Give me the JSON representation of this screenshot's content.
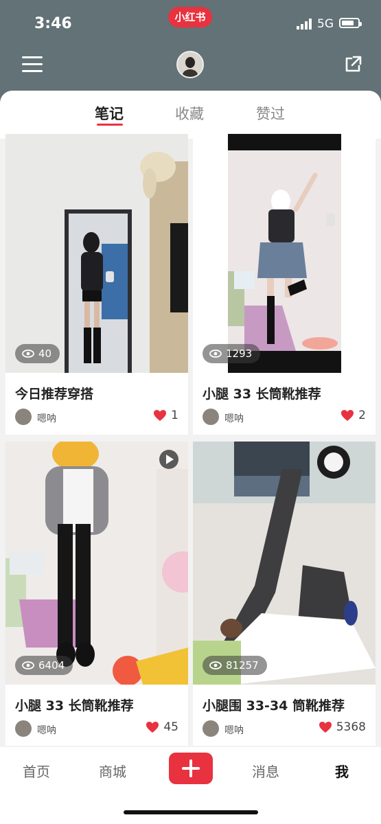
{
  "status": {
    "time": "3:46",
    "network": "5G"
  },
  "app_badge": "小红书",
  "tabs": [
    {
      "label": "笔记",
      "active": true
    },
    {
      "label": "收藏",
      "active": false
    },
    {
      "label": "赞过",
      "active": false
    }
  ],
  "posts": [
    {
      "views": "40",
      "title": "今日推荐穿搭",
      "author": "嗯呐",
      "likes": "1"
    },
    {
      "views": "1293",
      "title": "小腿 33 长筒靴推荐",
      "author": "嗯呐",
      "likes": "2"
    },
    {
      "views": "6404",
      "title": "小腿 33 长筒靴推荐",
      "author": "嗯呐",
      "likes": "45"
    },
    {
      "views": "81257",
      "title": "小腿围 33-34 筒靴推荐",
      "author": "嗯呐",
      "likes": "5368"
    }
  ],
  "nav": {
    "home": "首页",
    "mall": "商城",
    "messages": "消息",
    "me": "我"
  },
  "colors": {
    "accent": "#e8323f",
    "header": "#627276"
  }
}
